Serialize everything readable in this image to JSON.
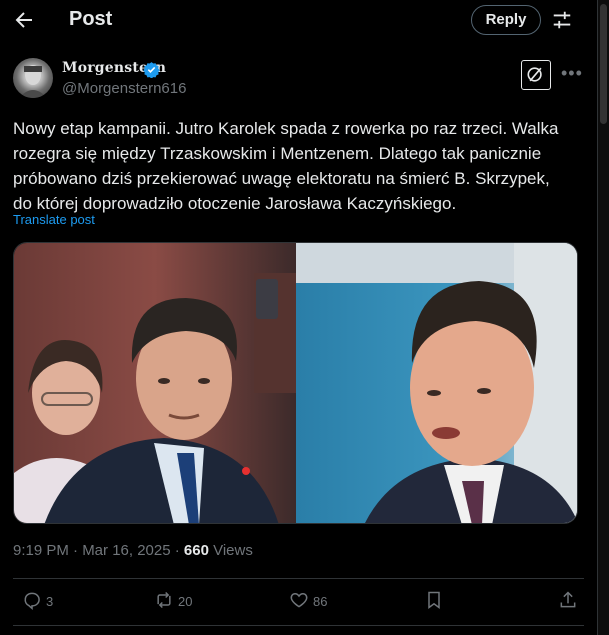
{
  "header": {
    "title": "Post",
    "reply_label": "Reply"
  },
  "author": {
    "display_name": "Morgenstern",
    "handle": "@Morgenstern616",
    "verified": true
  },
  "post": {
    "lines": [
      "Nowy etap kampanii. Jutro Karolek spada z rowerka po raz trzeci. Walka",
      "rozegra się między Trzaskowskim i Mentzenem. Dlatego tak panicznie",
      "próbowano dziś przekierować uwagę elektoratu na śmierć B. Skrzypek,",
      "do  której doprowadziło  otoczenie Jarosława Kaczyńskiego."
    ],
    "translate_label": "Translate post",
    "timestamp": "9:19 PM · Mar 16, 2025 · ",
    "views_count": "660",
    "views_label": " Views"
  },
  "actions": {
    "replies": "3",
    "reposts": "20",
    "likes": "86"
  },
  "icons": {
    "back": "arrow-left-icon",
    "sliders": "sliders-icon",
    "verified": "verified-badge-icon",
    "grok": "grok-icon",
    "more": "more-icon",
    "reply": "reply-icon",
    "repost": "repost-icon",
    "like": "heart-icon",
    "bookmark": "bookmark-icon",
    "share": "share-icon"
  },
  "colors": {
    "background": "#000000",
    "text": "#e7e9ea",
    "muted": "#71767b",
    "link": "#1d9bf0",
    "border": "#2f3336"
  }
}
